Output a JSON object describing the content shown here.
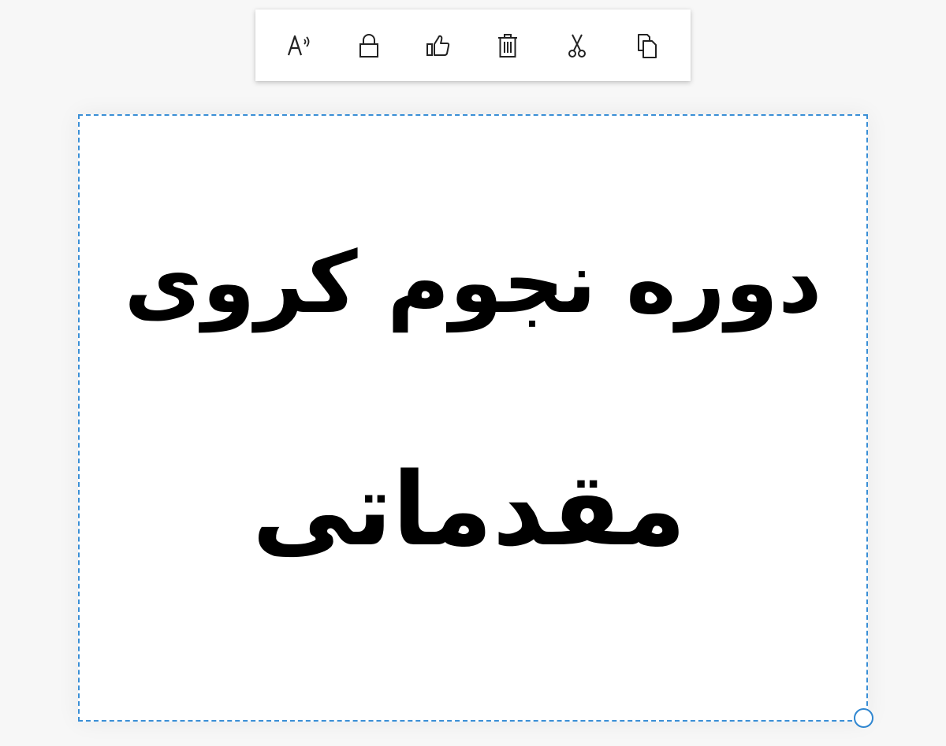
{
  "toolbar": {
    "buttons": [
      {
        "icon": "read-aloud-icon"
      },
      {
        "icon": "lock-icon"
      },
      {
        "icon": "thumbs-up-icon"
      },
      {
        "icon": "trash-icon"
      },
      {
        "icon": "scissors-icon"
      },
      {
        "icon": "copy-icon"
      }
    ]
  },
  "note": {
    "line1": "دوره نجوم کروی",
    "line2": "مقدماتی",
    "border_color": "#3a8fd6"
  }
}
